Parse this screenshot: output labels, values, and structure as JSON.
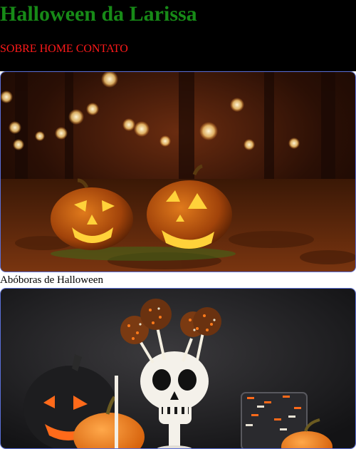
{
  "site": {
    "title": "Halloween da Larissa",
    "nav": [
      "SOBRE",
      "HOME",
      "CONTATO"
    ],
    "colors": {
      "title": "#178a17",
      "nav": "#ff1a1a",
      "header_bg": "#000000",
      "card_border": "#5a6fd8"
    }
  },
  "gallery": [
    {
      "image": "jack-o-lantern-pumpkins-photo",
      "caption": "Abóboras de Halloween"
    },
    {
      "image": "halloween-treats-skull-photo",
      "caption": ""
    }
  ]
}
